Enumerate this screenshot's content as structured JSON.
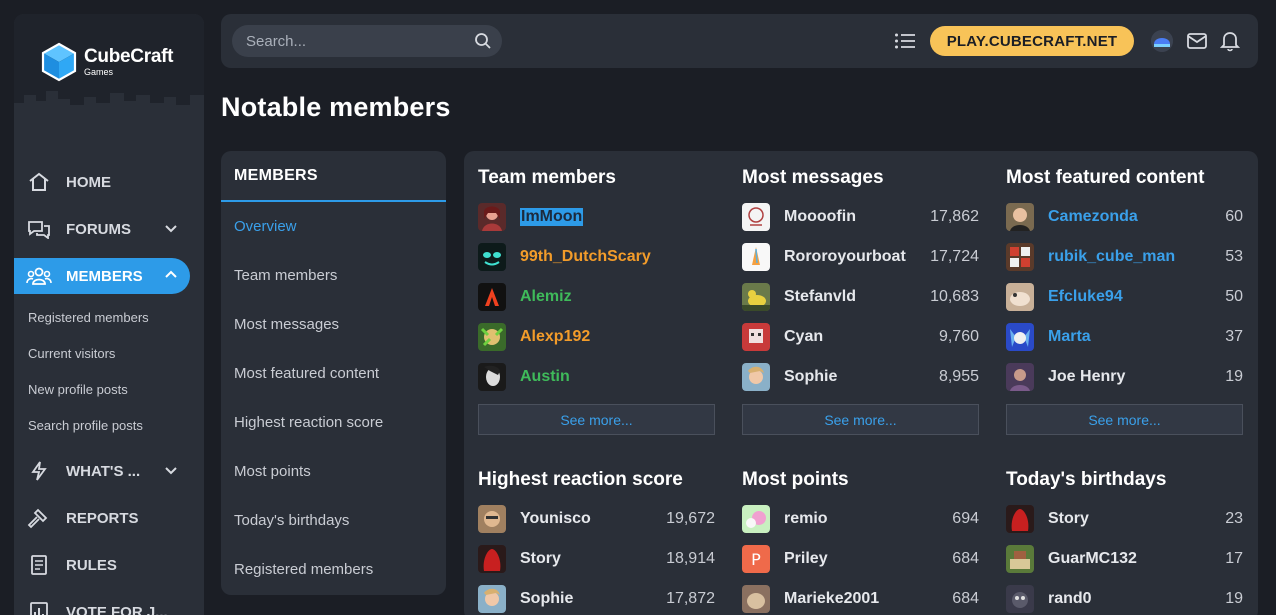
{
  "logo": {
    "main": "CubeCraft",
    "sub": "Games"
  },
  "sidebar": {
    "items": [
      {
        "label": "HOME",
        "icon": "home-icon"
      },
      {
        "label": "FORUMS",
        "icon": "forums-icon"
      },
      {
        "label": "MEMBERS",
        "icon": "members-icon"
      },
      {
        "label": "WHAT'S ...",
        "icon": "lightning-icon"
      },
      {
        "label": "REPORTS",
        "icon": "hammer-icon"
      },
      {
        "label": "RULES",
        "icon": "rules-icon"
      },
      {
        "label": "VOTE FOR J...",
        "icon": "vote-icon"
      }
    ],
    "members_sub": [
      "Registered members",
      "Current visitors",
      "New profile posts",
      "Search profile posts"
    ]
  },
  "topbar": {
    "search_placeholder": "Search...",
    "play_label": "PLAY.CUBECRAFT.NET"
  },
  "page_title": "Notable members",
  "members_nav": {
    "heading": "MEMBERS",
    "items": [
      "Overview",
      "Team members",
      "Most messages",
      "Most featured content",
      "Highest reaction score",
      "Most points",
      "Today's birthdays",
      "Registered members"
    ]
  },
  "see_more": "See more...",
  "blocks": {
    "team": {
      "title": "Team members",
      "rows": [
        {
          "name": "ImMoon",
          "color": "#2d9be8"
        },
        {
          "name": "99th_DutchScary",
          "color": "#f39c2a"
        },
        {
          "name": "Alemiz",
          "color": "#3fba5a"
        },
        {
          "name": "Alexp192",
          "color": "#f39c2a"
        },
        {
          "name": "Austin",
          "color": "#3fba5a"
        }
      ]
    },
    "messages": {
      "title": "Most messages",
      "rows": [
        {
          "name": "Moooofin",
          "value": "17,862"
        },
        {
          "name": "Rororoyourboat",
          "value": "17,724"
        },
        {
          "name": "Stefanvld",
          "value": "10,683"
        },
        {
          "name": "Cyan",
          "value": "9,760"
        },
        {
          "name": "Sophie",
          "value": "8,955"
        }
      ]
    },
    "featured": {
      "title": "Most featured content",
      "rows": [
        {
          "name": "Camezonda",
          "value": "60"
        },
        {
          "name": "rubik_cube_man",
          "value": "53"
        },
        {
          "name": "Efcluke94",
          "value": "50"
        },
        {
          "name": "Marta",
          "value": "37"
        },
        {
          "name": "Joe Henry",
          "value": "19"
        }
      ]
    },
    "reaction": {
      "title": "Highest reaction score",
      "rows": [
        {
          "name": "Younisco",
          "value": "19,672"
        },
        {
          "name": "Story",
          "value": "18,914"
        },
        {
          "name": "Sophie",
          "value": "17,872"
        }
      ]
    },
    "points": {
      "title": "Most points",
      "rows": [
        {
          "name": "remio",
          "value": "694"
        },
        {
          "name": "Priley",
          "value": "684"
        },
        {
          "name": "Marieke2001",
          "value": "684"
        }
      ]
    },
    "birthdays": {
      "title": "Today's birthdays",
      "rows": [
        {
          "name": "Story",
          "value": "23"
        },
        {
          "name": "GuarMC132",
          "value": "17"
        },
        {
          "name": "rand0",
          "value": "19"
        }
      ]
    }
  },
  "colors": {
    "accent": "#2d9be8",
    "play_button": "#f8c358",
    "panel": "#2a2f38",
    "background": "#1b1e25"
  }
}
